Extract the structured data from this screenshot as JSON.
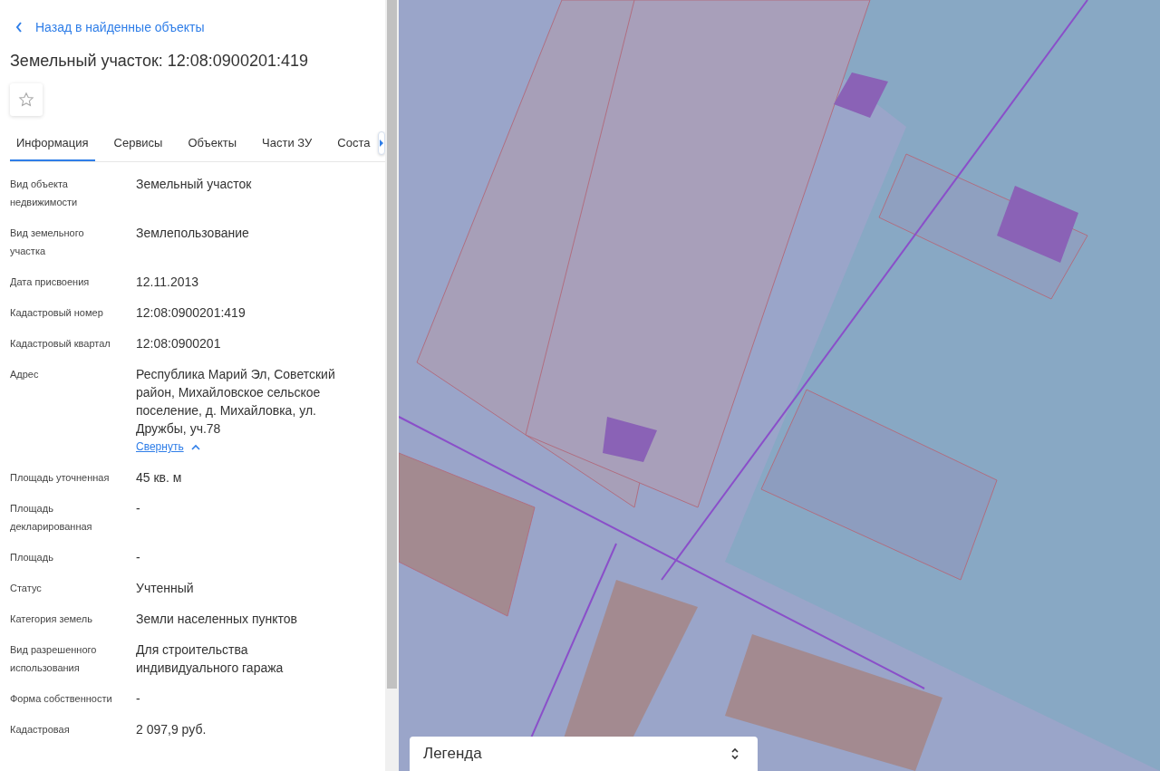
{
  "back_link": "Назад в найденные объекты",
  "title": "Земельный участок: 12:08:0900201:419",
  "tabs": [
    {
      "label": "Информация",
      "selected": true
    },
    {
      "label": "Сервисы",
      "selected": false
    },
    {
      "label": "Объекты",
      "selected": false
    },
    {
      "label": "Части ЗУ",
      "selected": false
    },
    {
      "label": "Соста",
      "selected": false
    }
  ],
  "properties": [
    {
      "label": "Вид объекта недвижимости",
      "value": "Земельный участок"
    },
    {
      "label": "Вид земельного участка",
      "value": "Землепользование"
    },
    {
      "label": "Дата присвоения",
      "value": "12.11.2013"
    },
    {
      "label": "Кадастровый номер",
      "value": "12:08:0900201:419"
    },
    {
      "label": "Кадастровый квартал",
      "value": "12:08:0900201"
    },
    {
      "label": "Адрес",
      "value": "Республика Марий Эл, Советский район, Михайловское сельское поселение, д. Михайловка, ул. Дружбы, уч.78",
      "link": "Свернуть"
    },
    {
      "label": "Площадь уточненная",
      "value": "45 кв. м"
    },
    {
      "label": "Площадь декларированная",
      "value": "-"
    },
    {
      "label": "Площадь",
      "value": "-"
    },
    {
      "label": "Статус",
      "value": "Учтенный"
    },
    {
      "label": "Категория земель",
      "value": "Земли населенных пунктов"
    },
    {
      "label": "Вид разрешенного использования",
      "value": "Для строительства индивидуального гаража"
    },
    {
      "label": "Форма собственности",
      "value": "-"
    },
    {
      "label": "Кадастровая",
      "value": "2 097,9 руб."
    }
  ],
  "legend": {
    "label": "Легенда"
  }
}
